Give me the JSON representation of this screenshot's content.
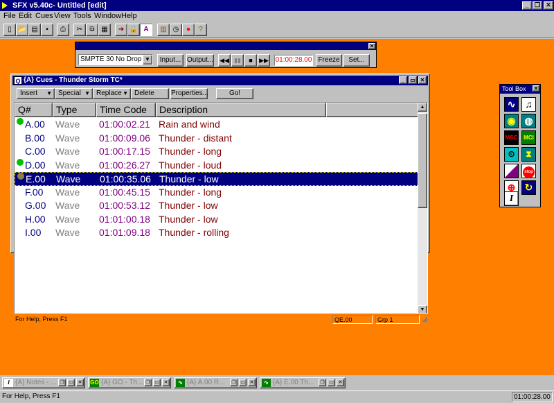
{
  "app": {
    "title": "SFX v5.40c- Untitled [edit]"
  },
  "menu": {
    "items": [
      "File",
      "Edit",
      "Cues",
      "View",
      "Tools",
      "Window",
      "Help"
    ]
  },
  "transport": {
    "timecode_select": "SMPTE 30 No Drop",
    "input_label": "Input...",
    "output_label": "Output...",
    "time_display": "01:00:28.00",
    "freeze_label": "Freeze",
    "set_label": "Set..."
  },
  "cues_window": {
    "title": "{A} Cues - Thunder Storm TC*",
    "toolbar": {
      "insert": "Insert",
      "special": "Special",
      "replace": "Replace",
      "delete": "Delete",
      "properties": "Properties...",
      "go": "Go!"
    },
    "columns": [
      "Q#",
      "Type",
      "Time Code",
      "Description"
    ],
    "rows": [
      {
        "q": "A.00",
        "type": "Wave",
        "tc": "01:00:02.21",
        "desc": "Rain and wind",
        "status": "green"
      },
      {
        "q": "B.00",
        "type": "Wave",
        "tc": "01:00:09.06",
        "desc": "Thunder - distant",
        "status": ""
      },
      {
        "q": "C.00",
        "type": "Wave",
        "tc": "01:00:17.15",
        "desc": "Thunder - long",
        "status": ""
      },
      {
        "q": "D.00",
        "type": "Wave",
        "tc": "01:00:26.27",
        "desc": "Thunder - loud",
        "status": "green"
      },
      {
        "q": "E.00",
        "type": "Wave",
        "tc": "01:00:35.06",
        "desc": "Thunder - low",
        "status": "olive"
      },
      {
        "q": "F.00",
        "type": "Wave",
        "tc": "01:00:45.15",
        "desc": "Thunder - long",
        "status": ""
      },
      {
        "q": "G.00",
        "type": "Wave",
        "tc": "01:00:53.12",
        "desc": "Thunder - low",
        "status": ""
      },
      {
        "q": "H.00",
        "type": "Wave",
        "tc": "01:01:00.18",
        "desc": "Thunder - low",
        "status": ""
      },
      {
        "q": "I.00",
        "type": "Wave",
        "tc": "01:01:09.18",
        "desc": "Thunder - rolling",
        "status": ""
      }
    ],
    "selected_row": 4,
    "status": {
      "help": "For Help, Press F1",
      "qe": "QE.00",
      "group": "Grp 1"
    }
  },
  "toolbox": {
    "title": "Tool Box",
    "tools": [
      "wave-icon",
      "music-icon",
      "cd-icon",
      "midi-icon",
      "msc-icon",
      "mci-icon",
      "wait-icon",
      "timer-icon",
      "fade-icon",
      "stop-icon",
      "target-icon",
      "loop-icon",
      "info-icon"
    ],
    "msc_label": "MSC",
    "mci_label": "MCI",
    "stop_label": "stop"
  },
  "taskbar": {
    "tasks": [
      {
        "label": "{A} Notes - ...",
        "icon": "I"
      },
      {
        "label": "{A} GO - Th...",
        "icon": "GO"
      },
      {
        "label": "{A} A.00 R...",
        "icon": "~"
      },
      {
        "label": "{A} E.00 Th...",
        "icon": "~"
      }
    ]
  },
  "statusbar": {
    "help": "For Help, Press F1",
    "time": "01:00:28.00"
  },
  "colors": {
    "workspace": "#ff8000",
    "titlebar": "#000080",
    "type_text": "#808080",
    "tc_text": "#800080",
    "desc_text": "#800000",
    "time_display": "#ff0000"
  }
}
